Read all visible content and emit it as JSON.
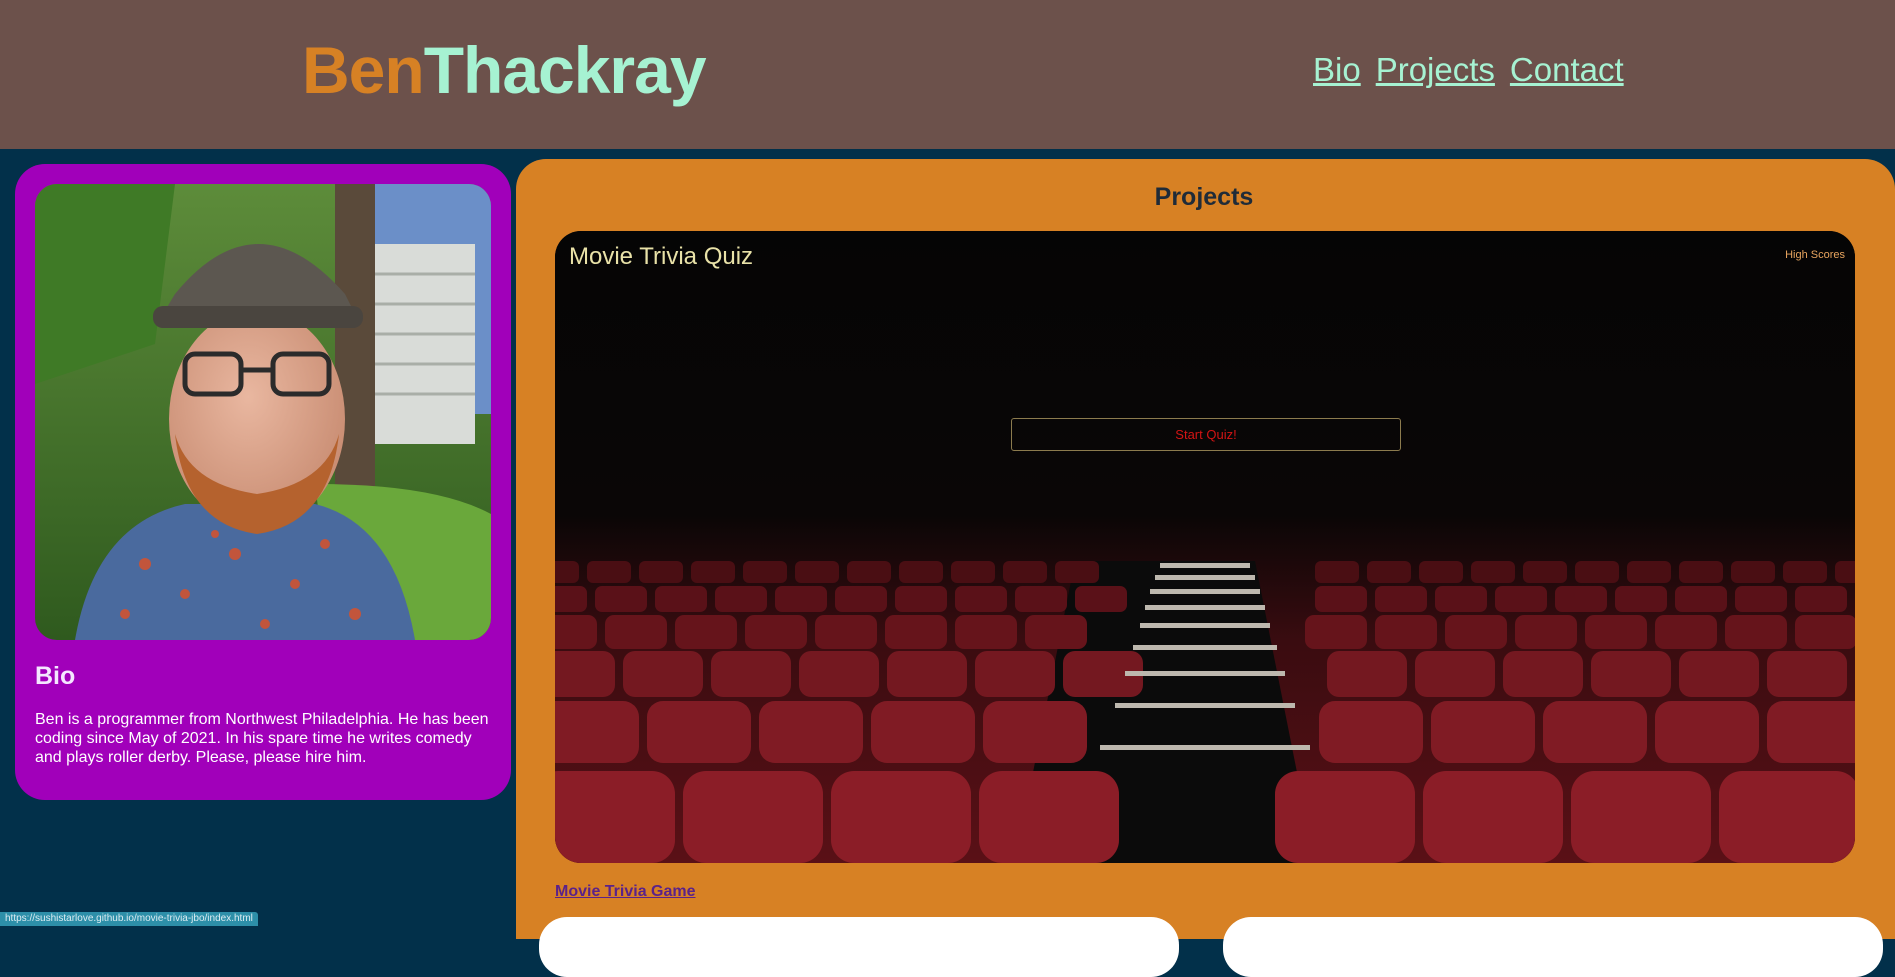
{
  "header": {
    "logo_first": "Ben",
    "logo_last": "Thackray",
    "nav": [
      "Bio",
      "Projects",
      "Contact"
    ]
  },
  "bio": {
    "photo_alt": "",
    "title": "Bio",
    "text": "Ben is a programmer from Northwest Philadelphia. He has been coding since May of 2021. In his spare time he writes comedy and plays roller derby. Please, please hire him."
  },
  "projects": {
    "title": "Projects",
    "items": [
      {
        "screenshot_title": "Movie Trivia Quiz",
        "high_scores_label": "High Scores",
        "start_button": "Start Quiz!",
        "link_label": "Movie Trivia Game"
      }
    ]
  },
  "status_bar": {
    "url": "https://sushistarlove.github.io/movie-trivia-jbo/index.html"
  },
  "colors": {
    "header_bg": "#6c514b",
    "page_bg": "#02304a",
    "logo_first": "#d78124",
    "logo_last": "#a6f2d2",
    "bio_card": "#a100ba",
    "projects_card": "#d78124"
  }
}
